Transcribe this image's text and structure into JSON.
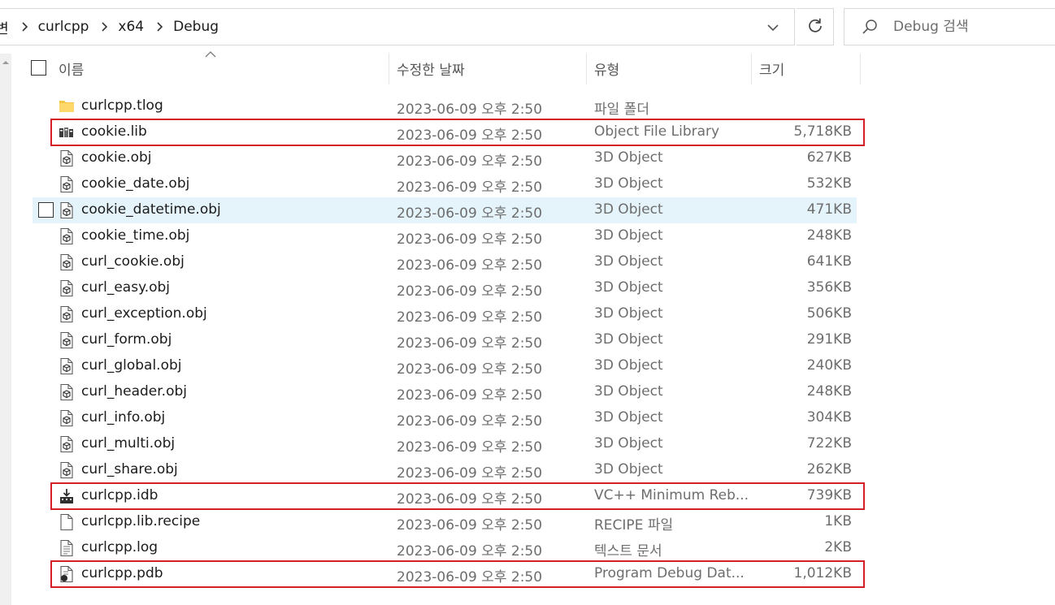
{
  "address": {
    "cut_segment": "변",
    "crumbs": [
      "curlcpp",
      "x64",
      "Debug"
    ]
  },
  "search": {
    "placeholder": "Debug 검색"
  },
  "columns": {
    "name": "이름",
    "date": "수정한 날짜",
    "type": "유형",
    "size": "크기"
  },
  "files": [
    {
      "name": "curlcpp.tlog",
      "date": "2023-06-09 오후 2:50",
      "type": "파일 폴더",
      "size": "",
      "icon": "folder-icon"
    },
    {
      "name": "cookie.lib",
      "date": "2023-06-09 오후 2:50",
      "type": "Object File Library",
      "size": "5,718KB",
      "icon": "library-file-icon"
    },
    {
      "name": "cookie.obj",
      "date": "2023-06-09 오후 2:50",
      "type": "3D Object",
      "size": "627KB",
      "icon": "3d-object-file-icon"
    },
    {
      "name": "cookie_date.obj",
      "date": "2023-06-09 오후 2:50",
      "type": "3D Object",
      "size": "532KB",
      "icon": "3d-object-file-icon"
    },
    {
      "name": "cookie_datetime.obj",
      "date": "2023-06-09 오후 2:50",
      "type": "3D Object",
      "size": "471KB",
      "icon": "3d-object-file-icon"
    },
    {
      "name": "cookie_time.obj",
      "date": "2023-06-09 오후 2:50",
      "type": "3D Object",
      "size": "248KB",
      "icon": "3d-object-file-icon"
    },
    {
      "name": "curl_cookie.obj",
      "date": "2023-06-09 오후 2:50",
      "type": "3D Object",
      "size": "641KB",
      "icon": "3d-object-file-icon"
    },
    {
      "name": "curl_easy.obj",
      "date": "2023-06-09 오후 2:50",
      "type": "3D Object",
      "size": "356KB",
      "icon": "3d-object-file-icon"
    },
    {
      "name": "curl_exception.obj",
      "date": "2023-06-09 오후 2:50",
      "type": "3D Object",
      "size": "506KB",
      "icon": "3d-object-file-icon"
    },
    {
      "name": "curl_form.obj",
      "date": "2023-06-09 오후 2:50",
      "type": "3D Object",
      "size": "291KB",
      "icon": "3d-object-file-icon"
    },
    {
      "name": "curl_global.obj",
      "date": "2023-06-09 오후 2:50",
      "type": "3D Object",
      "size": "240KB",
      "icon": "3d-object-file-icon"
    },
    {
      "name": "curl_header.obj",
      "date": "2023-06-09 오후 2:50",
      "type": "3D Object",
      "size": "248KB",
      "icon": "3d-object-file-icon"
    },
    {
      "name": "curl_info.obj",
      "date": "2023-06-09 오후 2:50",
      "type": "3D Object",
      "size": "304KB",
      "icon": "3d-object-file-icon"
    },
    {
      "name": "curl_multi.obj",
      "date": "2023-06-09 오후 2:50",
      "type": "3D Object",
      "size": "722KB",
      "icon": "3d-object-file-icon"
    },
    {
      "name": "curl_share.obj",
      "date": "2023-06-09 오후 2:50",
      "type": "3D Object",
      "size": "262KB",
      "icon": "3d-object-file-icon"
    },
    {
      "name": "curlcpp.idb",
      "date": "2023-06-09 오후 2:50",
      "type": "VC++ Minimum Reb...",
      "size": "739KB",
      "icon": "idb-file-icon"
    },
    {
      "name": "curlcpp.lib.recipe",
      "date": "2023-06-09 오후 2:50",
      "type": "RECIPE 파일",
      "size": "1KB",
      "icon": "blank-file-icon"
    },
    {
      "name": "curlcpp.log",
      "date": "2023-06-09 오후 2:50",
      "type": "텍스트 문서",
      "size": "2KB",
      "icon": "text-file-icon"
    },
    {
      "name": "curlcpp.pdb",
      "date": "2023-06-09 오후 2:50",
      "type": "Program Debug Dat...",
      "size": "1,012KB",
      "icon": "pdb-file-icon"
    }
  ],
  "hovered_row": "cookie_datetime.obj",
  "highlighted_rows": [
    "cookie.lib",
    "curlcpp.idb",
    "curlcpp.pdb"
  ],
  "colors": {
    "highlight_border": "#d62028",
    "hover_background": "#e5f3fb",
    "folder_yellow": "#f4c542"
  }
}
